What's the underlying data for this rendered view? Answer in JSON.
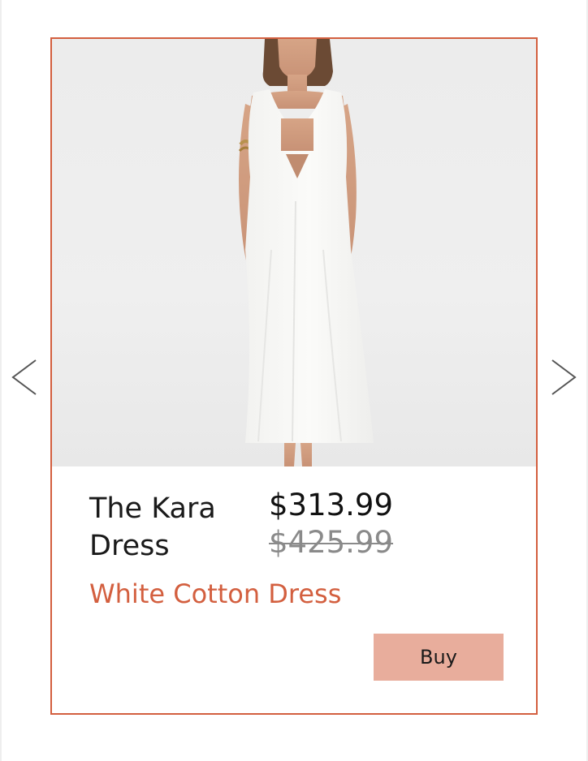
{
  "product": {
    "name": "The Kara Dress",
    "price_current": "$313.99",
    "price_original": "$425.99",
    "subtitle": "White Cotton Dress",
    "buy_label": "Buy",
    "image_icon": "dress-photo"
  },
  "carousel": {
    "prev_icon": "chevron-left-icon",
    "next_icon": "chevron-right-icon"
  },
  "colors": {
    "accent": "#d35f3f",
    "button": "#e8ad9c"
  }
}
